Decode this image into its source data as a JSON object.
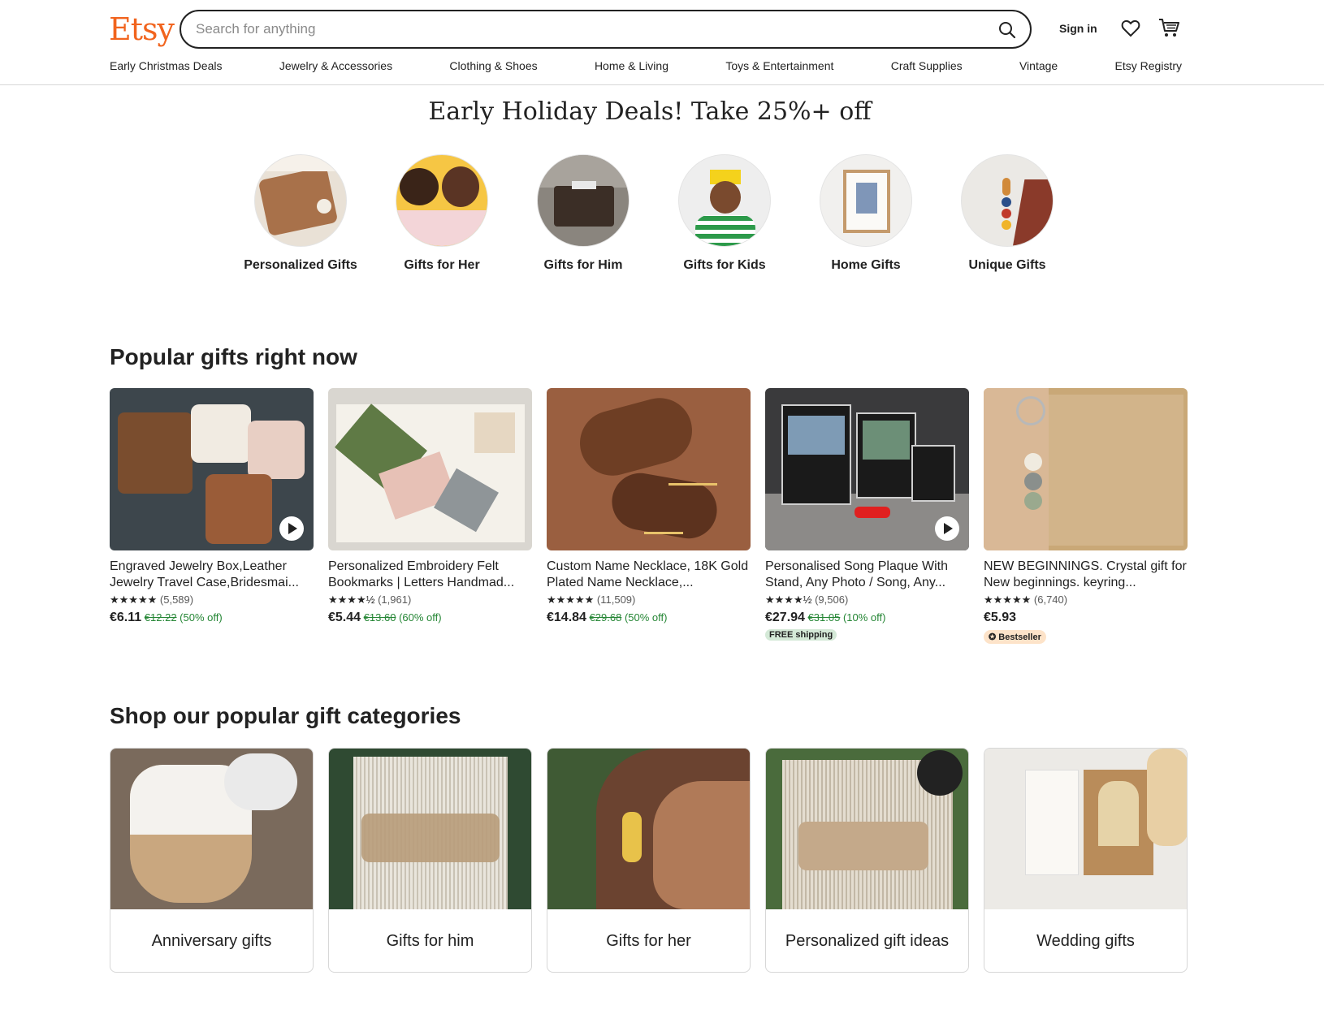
{
  "header": {
    "logo": "Etsy",
    "search_placeholder": "Search for anything",
    "sign_in": "Sign in",
    "icons": [
      "search-icon",
      "heart-icon",
      "cart-icon"
    ],
    "brand_color": "#f1641e"
  },
  "nav": [
    "Early Christmas Deals",
    "Jewelry & Accessories",
    "Clothing & Shoes",
    "Home & Living",
    "Toys & Entertainment",
    "Craft Supplies",
    "Vintage",
    "Etsy Registry"
  ],
  "hero": {
    "title": "Early Holiday Deals! Take 25%+ off",
    "circles": [
      {
        "label": "Personalized Gifts"
      },
      {
        "label": "Gifts for Her"
      },
      {
        "label": "Gifts for Him"
      },
      {
        "label": "Gifts for Kids"
      },
      {
        "label": "Home Gifts"
      },
      {
        "label": "Unique Gifts"
      }
    ]
  },
  "popular": {
    "title": "Popular gifts right now",
    "items": [
      {
        "title": "Engraved Jewelry Box,Leather Jewelry Travel Case,Bridesmai...",
        "stars": "★★★★★",
        "reviews": "(5,589)",
        "price": "€6.11",
        "original": "€12.22",
        "discount": "(50% off)",
        "video": true
      },
      {
        "title": "Personalized Embroidery Felt Bookmarks | Letters Handmad...",
        "stars": "★★★★½",
        "reviews": "(1,961)",
        "price": "€5.44",
        "original": "€13.60",
        "discount": "(60% off)"
      },
      {
        "title": "Custom Name Necklace, 18K Gold Plated Name Necklace,...",
        "stars": "★★★★★",
        "reviews": "(11,509)",
        "price": "€14.84",
        "original": "€29.68",
        "discount": "(50% off)"
      },
      {
        "title": "Personalised Song Plaque With Stand, Any Photo / Song, Any...",
        "stars": "★★★★½",
        "reviews": "(9,506)",
        "price": "€27.94",
        "original": "€31.05",
        "discount": "(10% off)",
        "badge": "FREE shipping",
        "video": true
      },
      {
        "title": "NEW BEGINNINGS. Crystal gift for New beginnings. keyring...",
        "stars": "★★★★★",
        "reviews": "(6,740)",
        "price": "€5.93",
        "badge": "Bestseller"
      }
    ]
  },
  "categories": {
    "title": "Shop our popular gift categories",
    "items": [
      {
        "label": "Anniversary gifts"
      },
      {
        "label": "Gifts for him"
      },
      {
        "label": "Gifts for her"
      },
      {
        "label": "Personalized gift ideas"
      },
      {
        "label": "Wedding gifts"
      }
    ]
  }
}
